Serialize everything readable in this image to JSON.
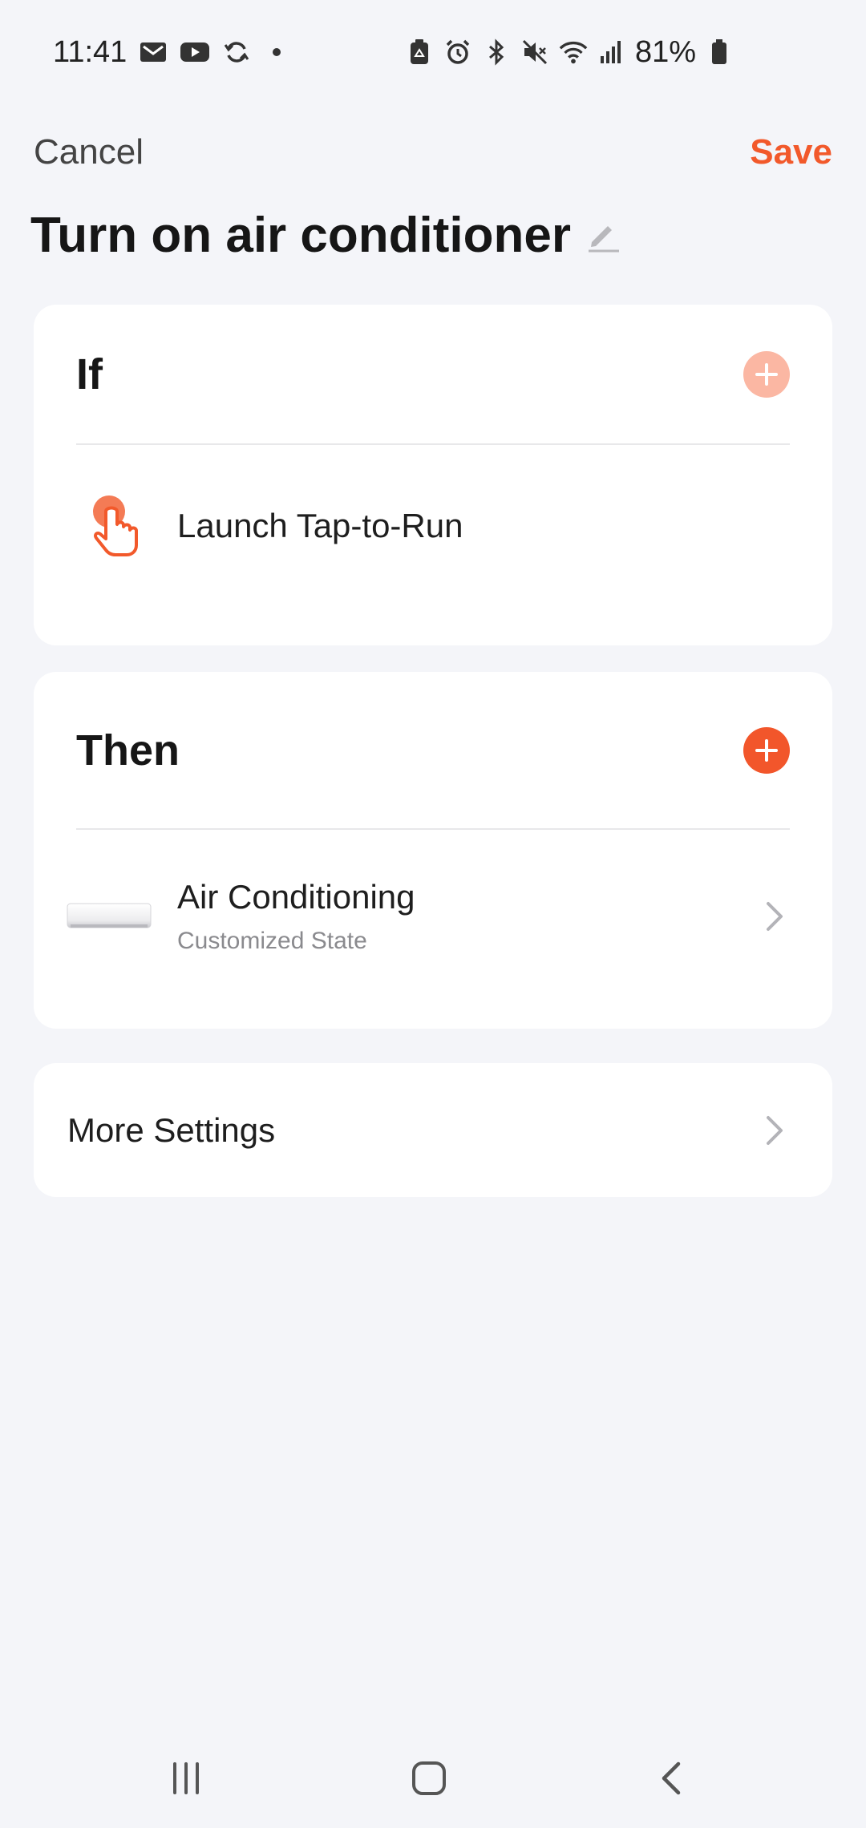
{
  "status_bar": {
    "time": "11:41",
    "battery_percent": "81%",
    "left_icons": [
      "gmail-icon",
      "youtube-icon",
      "sync-icon",
      "dot-icon"
    ],
    "right_icons": [
      "battery-saver-icon",
      "alarm-icon",
      "bluetooth-icon",
      "mute-icon",
      "wifi-icon",
      "signal-icon",
      "battery-icon"
    ]
  },
  "header": {
    "cancel_label": "Cancel",
    "save_label": "Save",
    "title": "Turn on air conditioner"
  },
  "if_section": {
    "title": "If",
    "add_enabled": false,
    "condition": {
      "label": "Launch Tap-to-Run",
      "icon": "tap-hand-icon"
    }
  },
  "then_section": {
    "title": "Then",
    "add_enabled": true,
    "action": {
      "label": "Air Conditioning",
      "sublabel": "Customized State",
      "icon": "air-conditioner-image"
    }
  },
  "more_settings": {
    "label": "More Settings"
  },
  "colors": {
    "accent": "#f2592b",
    "accent_disabled": "#fbb7a3",
    "background": "#f4f5f9",
    "card": "#ffffff"
  },
  "nav_bar": {
    "buttons": [
      "recents-icon",
      "home-icon",
      "back-icon"
    ]
  }
}
